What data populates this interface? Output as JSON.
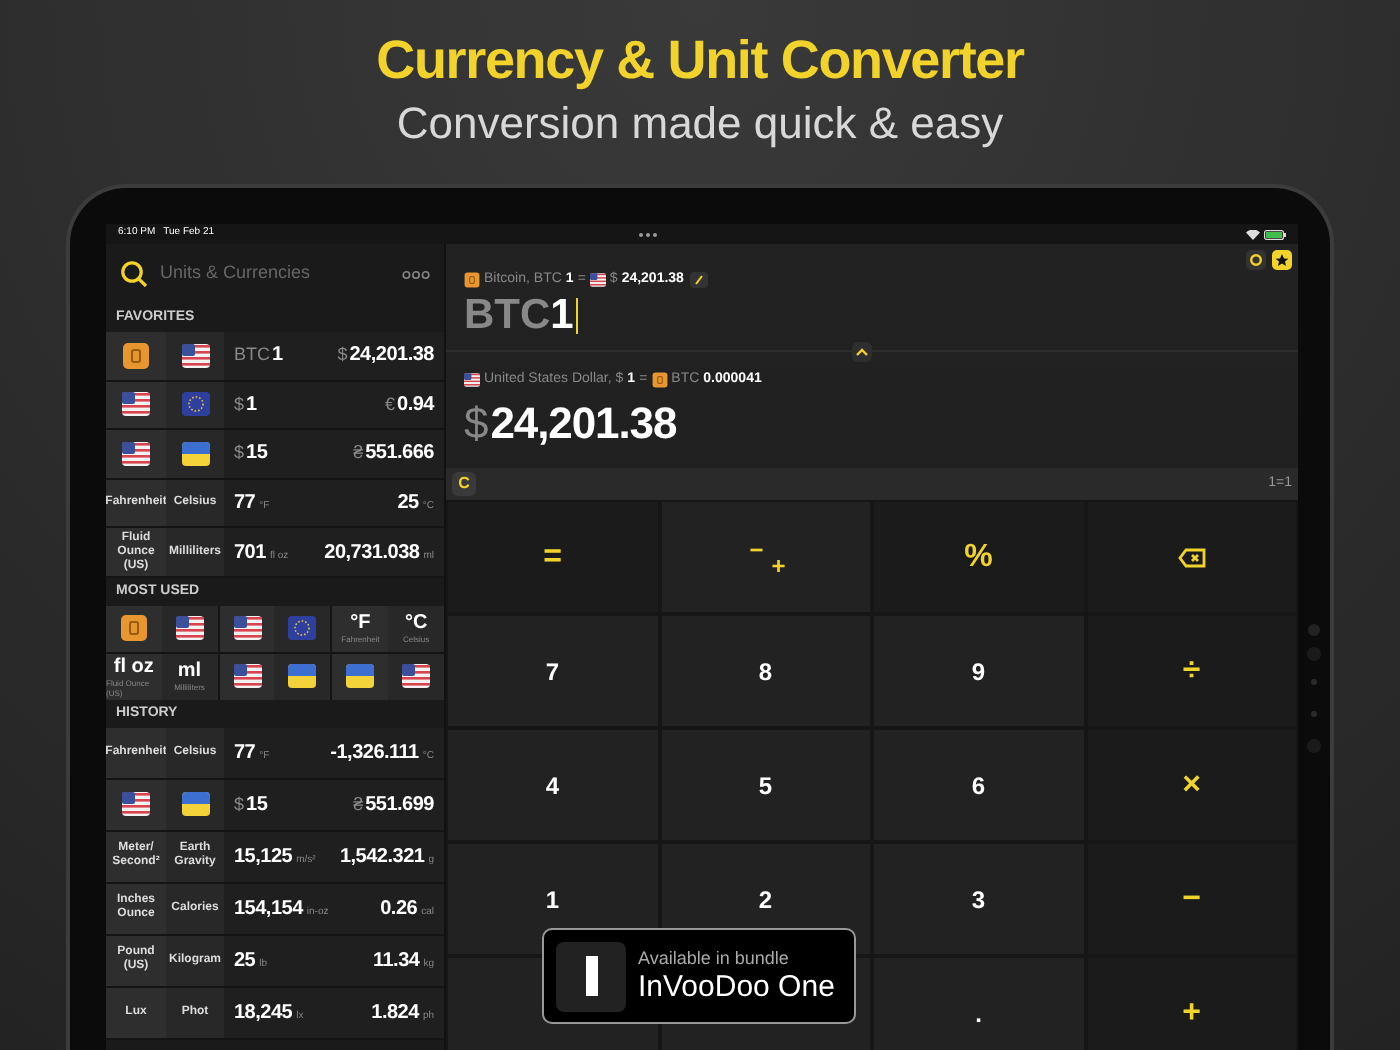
{
  "headline": {
    "title": "Currency & Unit Converter",
    "subtitle": "Conversion made quick & easy"
  },
  "status_bar": {
    "time": "6:10 PM",
    "date": "Tue Feb 21"
  },
  "sidebar": {
    "search": {
      "placeholder": "Units & Currencies"
    },
    "favorites": {
      "heading": "FAVORITES",
      "rows": [
        {
          "from": {
            "kind": "btc"
          },
          "to": {
            "kind": "us"
          },
          "value": {
            "prefix": "BTC",
            "amount": "1"
          },
          "result": {
            "prefix": "$",
            "amount": "24,201.38"
          }
        },
        {
          "from": {
            "kind": "us"
          },
          "to": {
            "kind": "eu"
          },
          "value": {
            "prefix": "$",
            "amount": "1"
          },
          "result": {
            "prefix": "€",
            "amount": "0.94"
          }
        },
        {
          "from": {
            "kind": "us"
          },
          "to": {
            "kind": "ua"
          },
          "value": {
            "prefix": "$",
            "amount": "15"
          },
          "result": {
            "prefix": "₴",
            "amount": "551.666"
          }
        },
        {
          "from": {
            "kind": "unit",
            "label": "Fahrenheit"
          },
          "to": {
            "kind": "unit",
            "label": "Celsius"
          },
          "value": {
            "amount": "77",
            "suffix": "°F"
          },
          "result": {
            "amount": "25",
            "suffix": "°C"
          }
        },
        {
          "from": {
            "kind": "unit",
            "label": "Fluid Ounce (US)"
          },
          "to": {
            "kind": "unit",
            "label": "Milliliters"
          },
          "value": {
            "amount": "701",
            "suffix": "fl oz"
          },
          "result": {
            "amount": "20,731.038",
            "suffix": "ml"
          }
        }
      ]
    },
    "most_used": {
      "heading": "MOST USED",
      "items": [
        {
          "from": {
            "kind": "btc"
          },
          "to": {
            "kind": "us"
          }
        },
        {
          "from": {
            "kind": "us"
          },
          "to": {
            "kind": "eu"
          }
        },
        {
          "from": {
            "kind": "symbol",
            "label": "°F",
            "sub": "Fahrenheit"
          },
          "to": {
            "kind": "symbol",
            "label": "°C",
            "sub": "Celsius"
          }
        },
        {
          "from": {
            "kind": "symbol",
            "label": "fl oz",
            "sub": "Fluid Ounce (US)"
          },
          "to": {
            "kind": "symbol",
            "label": "ml",
            "sub": "Milliliters"
          }
        },
        {
          "from": {
            "kind": "us"
          },
          "to": {
            "kind": "ua"
          }
        },
        {
          "from": {
            "kind": "ua"
          },
          "to": {
            "kind": "us"
          }
        }
      ]
    },
    "history": {
      "heading": "HISTORY",
      "rows": [
        {
          "from": {
            "kind": "unit",
            "label": "Fahrenheit"
          },
          "to": {
            "kind": "unit",
            "label": "Celsius"
          },
          "value": {
            "amount": "77",
            "suffix": "°F"
          },
          "result": {
            "amount": "-1,326.111",
            "suffix": "°C"
          }
        },
        {
          "from": {
            "kind": "us"
          },
          "to": {
            "kind": "ua"
          },
          "value": {
            "prefix": "$",
            "amount": "15"
          },
          "result": {
            "prefix": "₴",
            "amount": "551.699"
          }
        },
        {
          "from": {
            "kind": "unit",
            "label": "Meter/ Second²"
          },
          "to": {
            "kind": "unit",
            "label": "Earth Gravity"
          },
          "value": {
            "amount": "15,125",
            "suffix": "m/s²"
          },
          "result": {
            "amount": "1,542.321",
            "suffix": "g"
          }
        },
        {
          "from": {
            "kind": "unit",
            "label": "Inches Ounce"
          },
          "to": {
            "kind": "unit",
            "label": "Calories"
          },
          "value": {
            "amount": "154,154",
            "suffix": "in-oz"
          },
          "result": {
            "amount": "0.26",
            "suffix": "cal"
          }
        },
        {
          "from": {
            "kind": "unit",
            "label": "Pound (US)"
          },
          "to": {
            "kind": "unit",
            "label": "Kilogram"
          },
          "value": {
            "amount": "25",
            "suffix": "lb"
          },
          "result": {
            "amount": "11.34",
            "suffix": "kg"
          }
        },
        {
          "from": {
            "kind": "unit",
            "label": "Lux"
          },
          "to": {
            "kind": "unit",
            "label": "Phot"
          },
          "value": {
            "amount": "18,245",
            "suffix": "lx"
          },
          "result": {
            "amount": "1.824",
            "suffix": "ph"
          }
        }
      ]
    }
  },
  "converter": {
    "source": {
      "rate": {
        "from": {
          "kind": "btc",
          "name": "Bitcoin, BTC",
          "amount": "1"
        },
        "equals": "=",
        "to": {
          "kind": "us",
          "prefix": "$",
          "amount": "24,201.38"
        }
      },
      "prefix": "BTC",
      "amount": "1"
    },
    "target": {
      "rate": {
        "from": {
          "kind": "us",
          "name": "United States Dollar, $",
          "amount": "1"
        },
        "equals": "=",
        "to": {
          "kind": "btc",
          "prefix": "BTC",
          "amount": "0.000041"
        }
      },
      "prefix": "$",
      "amount": "24,201.38"
    },
    "clear": "C",
    "ratio": "1=1",
    "keys": [
      {
        "kind": "op",
        "label": "="
      },
      {
        "kind": "sign",
        "top": "−",
        "bottom": "+"
      },
      {
        "kind": "op",
        "label": "%"
      },
      {
        "kind": "backspace"
      },
      {
        "kind": "digit",
        "label": "7"
      },
      {
        "kind": "digit",
        "label": "8"
      },
      {
        "kind": "digit",
        "label": "9"
      },
      {
        "kind": "op",
        "label": "÷"
      },
      {
        "kind": "digit",
        "label": "4"
      },
      {
        "kind": "digit",
        "label": "5"
      },
      {
        "kind": "digit",
        "label": "6"
      },
      {
        "kind": "op",
        "label": "×"
      },
      {
        "kind": "digit",
        "label": "1"
      },
      {
        "kind": "digit",
        "label": "2"
      },
      {
        "kind": "digit",
        "label": "3"
      },
      {
        "kind": "op",
        "label": "−"
      },
      {
        "kind": "blank"
      },
      {
        "kind": "blank"
      },
      {
        "kind": "digit",
        "label": "."
      },
      {
        "kind": "op",
        "label": "+"
      }
    ]
  },
  "bundle_badge": {
    "caption": "Available in bundle",
    "name": "InVooDoo One"
  }
}
